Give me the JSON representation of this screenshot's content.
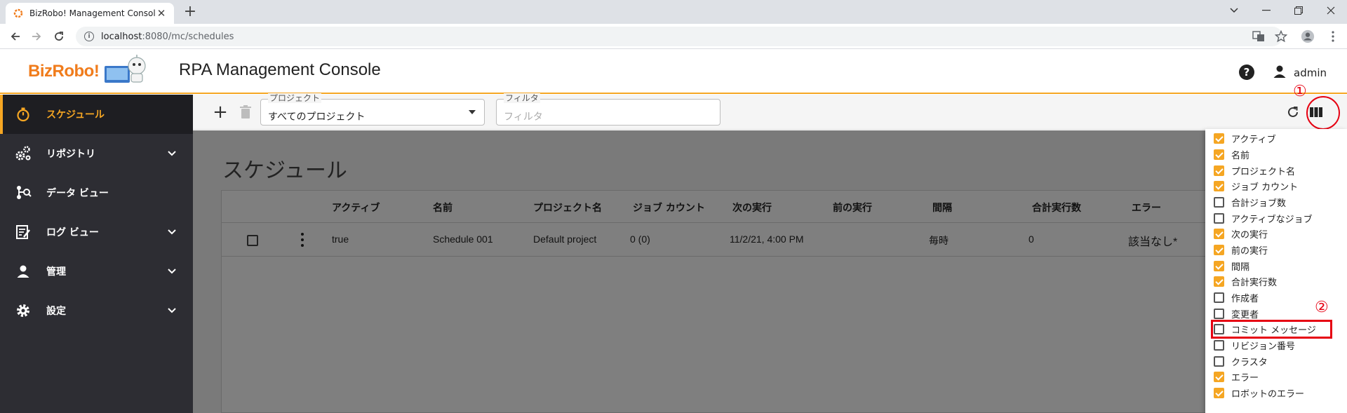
{
  "browser": {
    "tab_title": "BizRobo! Management Console",
    "tab_close": "✕",
    "new_tab": "+",
    "url_host": "localhost",
    "url_path": ":8080/mc/schedules"
  },
  "header": {
    "logo_text": "BizRobo!",
    "app_title": "RPA Management Console",
    "help_glyph": "?",
    "username": "admin"
  },
  "sidebar": {
    "items": [
      {
        "label": "スケジュール",
        "icon": "stopwatch-icon",
        "active": true
      },
      {
        "label": "リポジトリ",
        "icon": "gears-icon",
        "expandable": true
      },
      {
        "label": "データ ビュー",
        "icon": "data-view-icon"
      },
      {
        "label": "ログ ビュー",
        "icon": "log-icon",
        "expandable": true
      },
      {
        "label": "管理",
        "icon": "person-icon",
        "expandable": true
      },
      {
        "label": "設定",
        "icon": "gear-icon",
        "expandable": true
      }
    ]
  },
  "toolbar": {
    "add_glyph": "+",
    "project_label": "プロジェクト",
    "project_value": "すべてのプロジェクト",
    "filter_label": "フィルタ",
    "filter_placeholder": "フィルタ"
  },
  "markers": {
    "one": "①",
    "two": "②"
  },
  "page": {
    "title": "スケジュール",
    "columns": [
      "アクティブ",
      "名前",
      "プロジェクト名",
      "ジョブ カウント",
      "次の実行",
      "前の実行",
      "間隔",
      "合計実行数",
      "エラー"
    ],
    "rows": [
      {
        "active": "true",
        "name": "Schedule 001",
        "project": "Default project",
        "job_count": "0 (0)",
        "next_run": "11/2/21, 4:00 PM",
        "prev_run": "",
        "interval": "毎時",
        "total_runs": "0",
        "error": "該当なし*"
      }
    ]
  },
  "column_menu": {
    "items": [
      {
        "label": "アクティブ",
        "checked": true
      },
      {
        "label": "名前",
        "checked": true
      },
      {
        "label": "プロジェクト名",
        "checked": true
      },
      {
        "label": "ジョブ カウント",
        "checked": true
      },
      {
        "label": "合計ジョブ数",
        "checked": false
      },
      {
        "label": "アクティブなジョブ",
        "checked": false
      },
      {
        "label": "次の実行",
        "checked": true
      },
      {
        "label": "前の実行",
        "checked": true
      },
      {
        "label": "間隔",
        "checked": true
      },
      {
        "label": "合計実行数",
        "checked": true
      },
      {
        "label": "作成者",
        "checked": false
      },
      {
        "label": "変更者",
        "checked": false
      },
      {
        "label": "コミット メッセージ",
        "checked": false
      },
      {
        "label": "リビジョン番号",
        "checked": false
      },
      {
        "label": "クラスタ",
        "checked": false
      },
      {
        "label": "エラー",
        "checked": true
      },
      {
        "label": "ロボットのエラー",
        "checked": true
      }
    ]
  },
  "colors": {
    "accent": "#f5a623",
    "sidebar_bg": "#2d2d33",
    "highlight_red": "#e60012"
  }
}
